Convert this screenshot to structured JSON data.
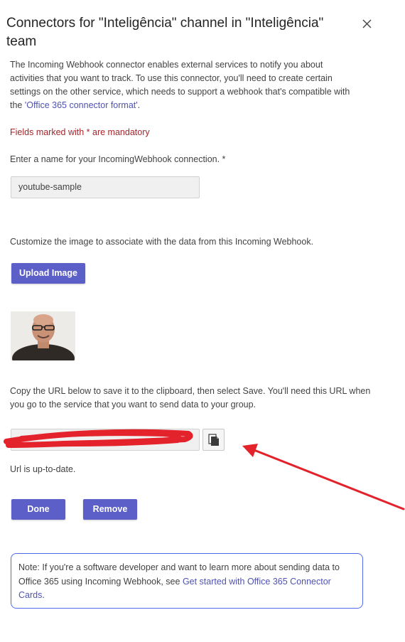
{
  "dialog": {
    "title": "Connectors for \"Inteligência\" channel in \"Inteligência\" team",
    "close_icon": "close-icon"
  },
  "intro": {
    "text": "The Incoming Webhook connector enables external services to notify you about activities that you want to track. To use this connector, you'll need to create certain settings on the other service, which needs to support a webhook that's compatible with the ",
    "link": "'Office 365 connector format'",
    "suffix": "."
  },
  "mandatory_note": "Fields marked with * are mandatory",
  "name_field": {
    "label": "Enter a name for your IncomingWebhook connection. *",
    "value": "youtube-sample"
  },
  "image_section": {
    "label": "Customize the image to associate with the data from this Incoming Webhook.",
    "upload_label": "Upload Image"
  },
  "url_section": {
    "label": "Copy the URL below to save it to the clipboard, then select Save. You'll need this URL when you go to the service that you want to send data to your group.",
    "copy_icon": "copy-icon",
    "status": "Url is up-to-date."
  },
  "actions": {
    "done_label": "Done",
    "remove_label": "Remove"
  },
  "note": {
    "text": "Note: If you're a software developer and want to learn more about sending data to Office 365 using Incoming Webhook, see ",
    "link": "Get started with Office 365 Connector Cards",
    "suffix": "."
  },
  "colors": {
    "accent": "#5b5fc7",
    "link": "#4f52b2",
    "mandatory": "#a4262c",
    "annotation": "#e3222b"
  }
}
